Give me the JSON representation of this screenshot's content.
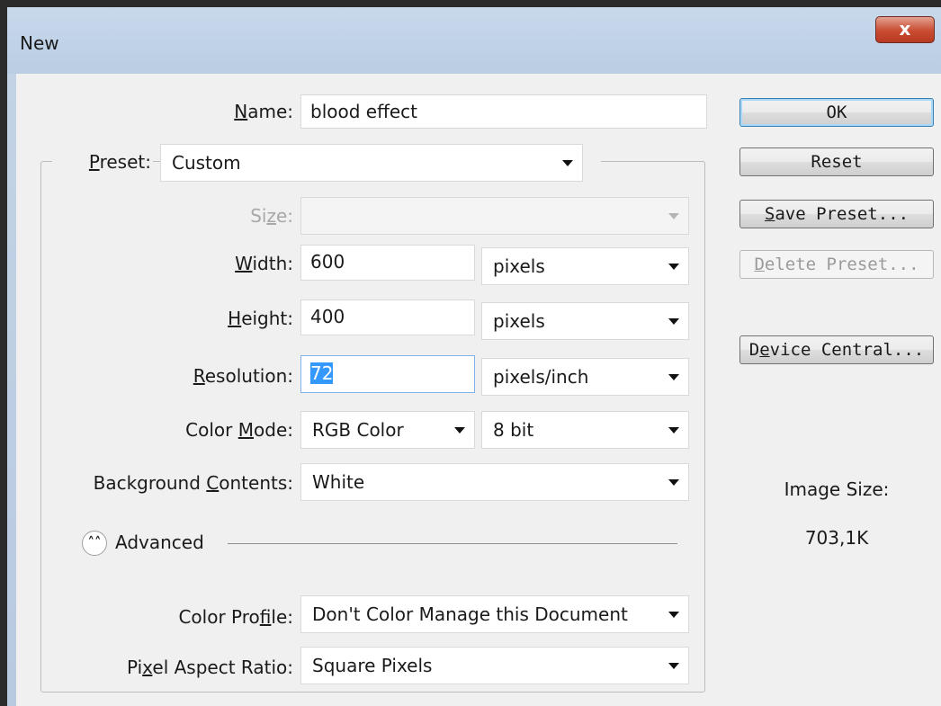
{
  "window": {
    "title": "New",
    "close_glyph": "x"
  },
  "form": {
    "name": {
      "label_pre": "",
      "label_acc": "N",
      "label_post": "ame:",
      "value": "blood effect"
    },
    "preset": {
      "label_pre": "",
      "label_acc": "P",
      "label_post": "reset:",
      "value": "Custom"
    },
    "size": {
      "label_pre": "Si",
      "label_acc": "z",
      "label_post": "e:",
      "value": ""
    },
    "width": {
      "label_pre": "",
      "label_acc": "W",
      "label_post": "idth:",
      "value": "600",
      "unit": "pixels"
    },
    "height": {
      "label_pre": "",
      "label_acc": "H",
      "label_post": "eight:",
      "value": "400",
      "unit": "pixels"
    },
    "resolution": {
      "label_pre": "",
      "label_acc": "R",
      "label_post": "esolution:",
      "value": "72",
      "unit": "pixels/inch"
    },
    "color_mode": {
      "label_pre": "Color ",
      "label_acc": "M",
      "label_post": "ode:",
      "value": "RGB Color",
      "bits": "8 bit"
    },
    "background": {
      "label_pre": "Background ",
      "label_acc": "C",
      "label_post": "ontents:",
      "value": "White"
    },
    "advanced": {
      "label": "Advanced",
      "toggle_icon": "chevron-double-up-icon"
    },
    "color_profile": {
      "label_pre": "Color Pro",
      "label_acc": "f",
      "label_post": "ile:",
      "value": "Don't Color Manage this Document"
    },
    "pixel_aspect": {
      "label_pre": "Pi",
      "label_acc": "x",
      "label_post": "el Aspect Ratio:",
      "value": "Square Pixels"
    }
  },
  "buttons": {
    "ok": {
      "pre": "",
      "acc": "",
      "post": "OK"
    },
    "reset": {
      "pre": "",
      "acc": "",
      "post": "Reset"
    },
    "save_preset": {
      "pre": "",
      "acc": "S",
      "post": "ave Preset..."
    },
    "delete_preset": {
      "pre": "",
      "acc": "D",
      "post": "elete Preset..."
    },
    "device_central": {
      "pre": "D",
      "acc": "e",
      "post": "vice Central..."
    }
  },
  "info": {
    "image_size_label": "Image Size:",
    "image_size_value": "703,1K"
  },
  "colors": {
    "selection": "#3399ff",
    "title_bar": "#c4d4e6",
    "close_button": "#c94b32",
    "client": "#f0f0f0"
  }
}
